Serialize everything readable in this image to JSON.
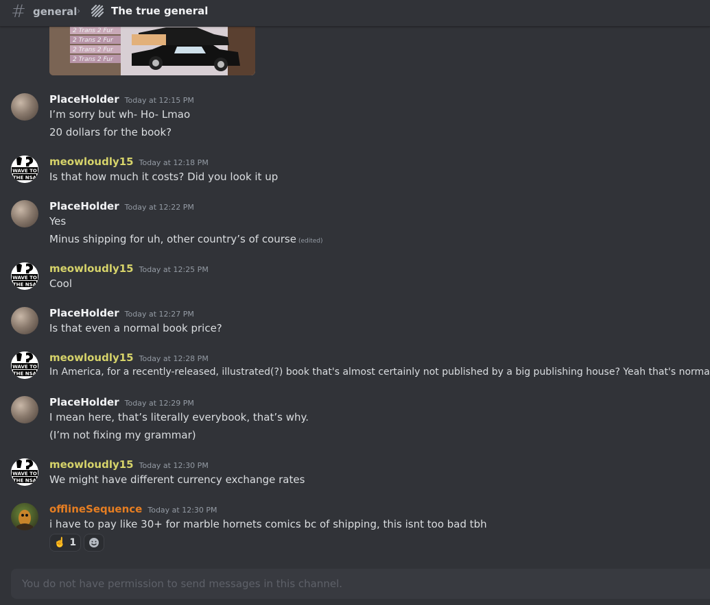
{
  "header": {
    "channel": "general",
    "thread": "The true general"
  },
  "messages": [
    {
      "author": "PlaceHolder",
      "time": "Today at 12:15 PM",
      "lines": [
        "I’m sorry but wh- Ho- Lmao",
        "20 dollars for the book?"
      ]
    },
    {
      "author": "meowloudly15",
      "time": "Today at 12:18 PM",
      "lines": [
        "Is that how much it costs? Did you look it up"
      ]
    },
    {
      "author": "PlaceHolder",
      "time": "Today at 12:22 PM",
      "lines": [
        "Yes",
        "Minus shipping for uh, other country’s of course"
      ],
      "edited": "(edited)"
    },
    {
      "author": "meowloudly15",
      "time": "Today at 12:25 PM",
      "lines": [
        "Cool"
      ]
    },
    {
      "author": "PlaceHolder",
      "time": "Today at 12:27 PM",
      "lines": [
        "Is that even a normal book price?"
      ]
    },
    {
      "author": "meowloudly15",
      "time": "Today at 12:28 PM",
      "lines": [
        "In America, for a recently-released, illustrated(?) book that's almost certainly not published by a big publishing house? Yeah that's normal"
      ]
    },
    {
      "author": "PlaceHolder",
      "time": "Today at 12:29 PM",
      "lines": [
        "I mean here, that’s literally everybook, that’s why.",
        "(I’m not fixing my grammar)"
      ]
    },
    {
      "author": "meowloudly15",
      "time": "Today at 12:30 PM",
      "lines": [
        "We might have different currency exchange rates"
      ]
    },
    {
      "author": "offlineSequence",
      "time": "Today at 12:30 PM",
      "lines": [
        "i have to pay like 30+ for marble hornets comics bc of shipping, this isnt too bad tbh"
      ]
    }
  ],
  "avatar_text": {
    "line1": "WAVE TO",
    "line2": "THE NSA"
  },
  "attachment": {
    "book_text": "2 Trans 2 Fur"
  },
  "reactions": [
    {
      "emoji": "☝️",
      "count": "1"
    },
    {
      "emoji": "add-reaction-icon"
    }
  ],
  "composer": {
    "placeholder": "You do not have permission to send messages in this channel."
  },
  "colors": {
    "background": "#313338",
    "meow_name": "#d6d36a",
    "offline_name": "#e67e22"
  }
}
